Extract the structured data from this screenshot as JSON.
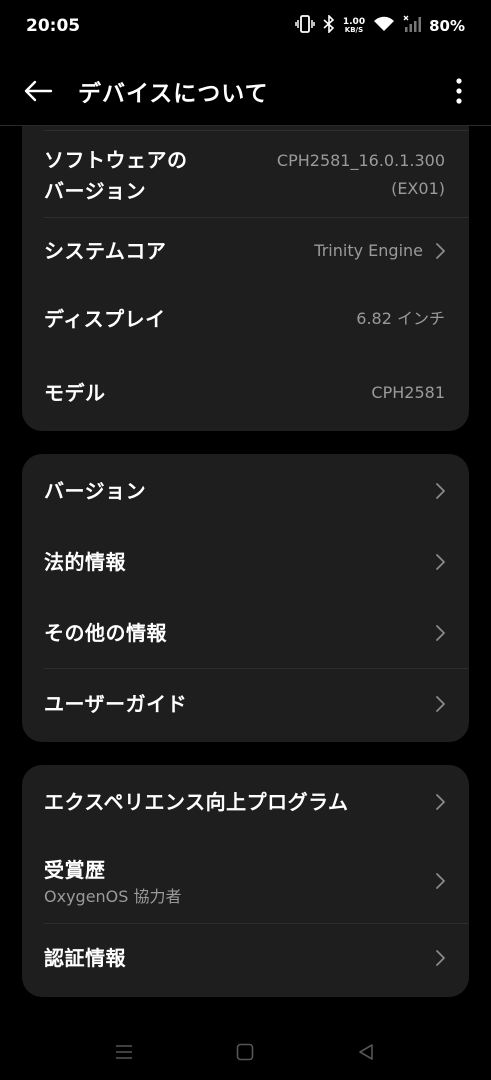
{
  "status": {
    "time": "20:05",
    "net_speed": "1.00",
    "net_unit": "KB/S",
    "battery": "80%"
  },
  "header": {
    "title": "デバイスについて"
  },
  "card1": {
    "software_version": {
      "label_line1": "ソフトウェアの",
      "label_line2": "バージョン",
      "value_line1": "CPH2581_16.0.1.300",
      "value_line2": "(EX01)"
    },
    "system_core": {
      "label": "システムコア",
      "value": "Trinity Engine"
    },
    "display": {
      "label": "ディスプレイ",
      "value": "6.82 インチ"
    },
    "model": {
      "label": "モデル",
      "value": "CPH2581"
    }
  },
  "card2": {
    "items": [
      {
        "label": "バージョン"
      },
      {
        "label": "法的情報"
      },
      {
        "label": "その他の情報"
      },
      {
        "label": "ユーザーガイド"
      }
    ]
  },
  "card3": {
    "experience": {
      "label": "エクスペリエンス向上プログラム"
    },
    "awards": {
      "label": "受賞歴",
      "sublabel": "OxygenOS 協力者"
    },
    "certification": {
      "label": "認証情報"
    }
  },
  "colors": {
    "background": "#000000",
    "card": "#1e1e1e",
    "secondary_text": "#9a9a9a"
  }
}
